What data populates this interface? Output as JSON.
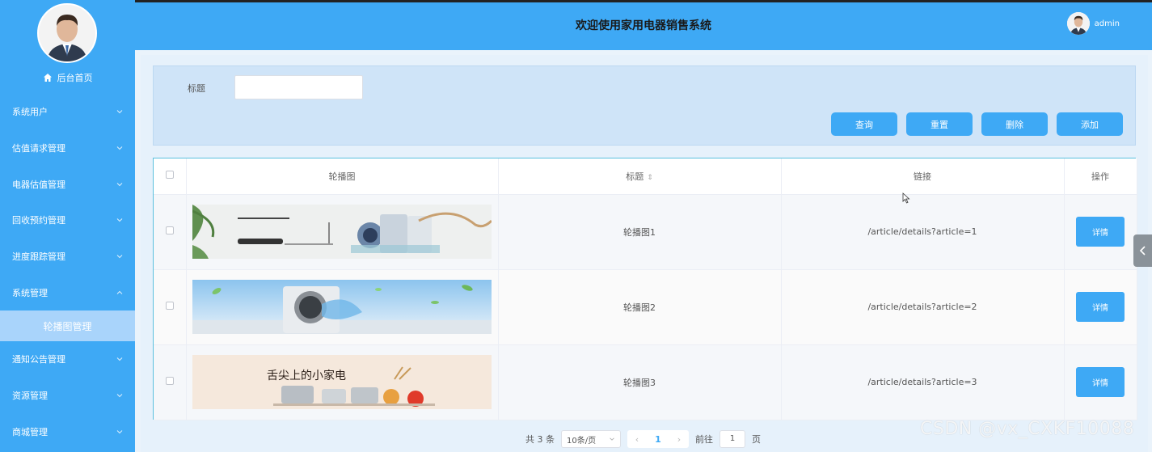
{
  "header": {
    "title": "欢迎使用家用电器销售系统",
    "username": "admin"
  },
  "sidebar": {
    "home_label": "后台首页",
    "items": [
      {
        "label": "系统用户"
      },
      {
        "label": "估值请求管理"
      },
      {
        "label": "电器估值管理"
      },
      {
        "label": "回收预约管理"
      },
      {
        "label": "进度跟踪管理"
      },
      {
        "label": "系统管理",
        "expanded": true
      },
      {
        "label": "通知公告管理"
      },
      {
        "label": "资源管理"
      },
      {
        "label": "商城管理"
      }
    ],
    "active_sub_item": "轮播图管理"
  },
  "search": {
    "label": "标题",
    "value": "",
    "placeholder": ""
  },
  "actions": {
    "query": "查询",
    "reset": "重置",
    "delete": "删除",
    "add": "添加"
  },
  "table": {
    "columns": [
      "轮播图",
      "标题",
      "链接",
      "操作"
    ],
    "rows": [
      {
        "title": "轮播图1",
        "link": "/article/details?article=1",
        "action": "详情"
      },
      {
        "title": "轮播图2",
        "link": "/article/details?article=2",
        "action": "详情"
      },
      {
        "title": "轮播图3",
        "link": "/article/details?article=3",
        "action": "详情"
      }
    ]
  },
  "pagination": {
    "total": "共 3 条",
    "page_size": "10条/页",
    "current_page": "1",
    "goto_label": "前往",
    "goto_value": "1",
    "page_unit": "页"
  },
  "banner3_text": "舌尖上的小家电",
  "watermark": "CSDN @vx_CXKF10088",
  "colors": {
    "primary": "#3ea9f5",
    "sidebar_sub_active": "#a9d4fb",
    "panel": "#cfe4f8"
  }
}
